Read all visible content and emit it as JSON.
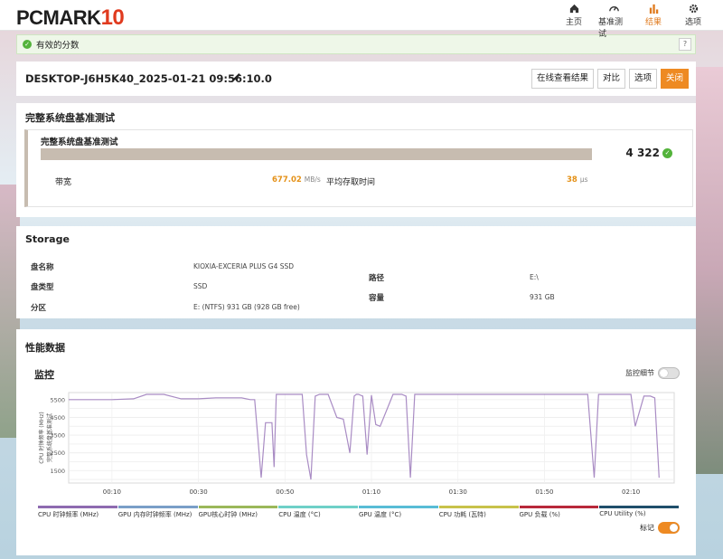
{
  "app": {
    "logo_main": "PCMARK",
    "logo_num": "10"
  },
  "nav": [
    {
      "label": "主页",
      "icon": "home-icon"
    },
    {
      "label": "基准测试",
      "icon": "gauge-icon"
    },
    {
      "label": "结果",
      "icon": "bar-chart-icon",
      "active": true
    },
    {
      "label": "选项",
      "icon": "gear-icon"
    }
  ],
  "alert": {
    "text": "有效的分数",
    "help": "?"
  },
  "result": {
    "title": "DESKTOP-J6H5K40_2025-01-21 09:56:10.0",
    "buttons": {
      "online": "在线查看结果",
      "compare": "对比",
      "options": "选项",
      "close": "关闭"
    }
  },
  "benchmark": {
    "section_title": "完整系统盘基准测试",
    "test_name": "完整系统盘基准测试",
    "score": "4 322",
    "bandwidth": {
      "label": "带宽",
      "value": "677.02",
      "unit": "MB/s"
    },
    "access_time": {
      "label": "平均存取时间",
      "value": "38",
      "unit": "μs"
    }
  },
  "storage": {
    "title": "Storage",
    "drive_name_label": "盘名称",
    "drive_name": "KIOXIA-EXCERIA PLUS G4 SSD",
    "drive_type_label": "盘类型",
    "drive_type": "SSD",
    "partition_label": "分区",
    "partition": "E: (NTFS) 931 GB (928 GB free)",
    "path_label": "路径",
    "path": "E:\\",
    "capacity_label": "容量",
    "capacity": "931 GB"
  },
  "perf": {
    "title": "性能数据",
    "monitor_title": "监控",
    "monitor_detail_label": "监控细节",
    "monitor_detail_on": false,
    "mark_label": "标记",
    "mark_on": true
  },
  "chart_data": {
    "type": "line",
    "ylabel": "CPU 时钟频率 (MHz)",
    "ylabel2": "完整系统盘基准测试",
    "yticks": [
      5500,
      5000,
      4500,
      4000,
      3500,
      3000,
      2500,
      2000,
      1500,
      1000
    ],
    "ylim": [
      800,
      5900
    ],
    "xticks": [
      "00:10",
      "00:30",
      "00:50",
      "01:10",
      "01:30",
      "01:50",
      "02:10"
    ],
    "xlim": [
      0,
      140
    ],
    "xtick_values": [
      10,
      30,
      50,
      70,
      90,
      110,
      130
    ],
    "line_color": "#a98cc4",
    "series": [
      {
        "name": "CPU 时钟频率 (MHz)",
        "x": [
          0,
          5,
          10,
          15,
          18,
          22,
          26,
          30,
          34,
          36,
          38,
          40,
          42,
          43,
          44.5,
          45.5,
          47,
          47.5,
          48,
          50,
          53,
          54,
          55,
          56,
          57,
          58,
          60,
          62,
          63.5,
          65,
          66,
          66.5,
          67,
          68,
          69,
          70,
          71,
          72,
          75,
          76,
          77,
          78,
          79,
          80,
          82,
          84,
          86,
          88,
          90,
          92,
          94,
          96,
          97,
          98,
          99,
          100,
          110,
          120,
          121.5,
          122.5,
          123.5,
          125,
          129,
          130,
          131,
          133,
          134.5,
          135.5,
          136.5
        ],
        "y": [
          5500,
          5500,
          5500,
          5550,
          5800,
          5800,
          5550,
          5550,
          5600,
          5600,
          5600,
          5600,
          5500,
          5500,
          1100,
          4200,
          4200,
          1700,
          5800,
          5800,
          5800,
          5800,
          2400,
          1000,
          5700,
          5800,
          5800,
          4500,
          4400,
          2500,
          5700,
          5800,
          5800,
          5700,
          2400,
          5750,
          4100,
          4000,
          5800,
          5800,
          5800,
          5700,
          1100,
          5800,
          5800,
          5800,
          5800,
          5800,
          5800,
          5800,
          5800,
          5800,
          5800,
          5800,
          5800,
          5800,
          5800,
          5800,
          1100,
          5800,
          5800,
          5800,
          5800,
          5800,
          4000,
          5700,
          5700,
          5600,
          1100
        ]
      }
    ],
    "legend": [
      {
        "label": "CPU 时钟频率 (MHz)",
        "color": "#8e6bb0"
      },
      {
        "label": "GPU 内存时钟频率 (MHz)",
        "color": "#7a9ec8"
      },
      {
        "label": "GPU核心时钟 (MHz)",
        "color": "#9bb85a"
      },
      {
        "label": "CPU 温度 (°C)",
        "color": "#6fd0c8"
      },
      {
        "label": "GPU 温度 (°C)",
        "color": "#58bcd6"
      },
      {
        "label": "CPU 功耗 (瓦特)",
        "color": "#c8c24a"
      },
      {
        "label": "GPU 负载 (%)",
        "color": "#b8283a"
      },
      {
        "label": "CPU Utility (%)",
        "color": "#1f4f6b"
      }
    ]
  }
}
